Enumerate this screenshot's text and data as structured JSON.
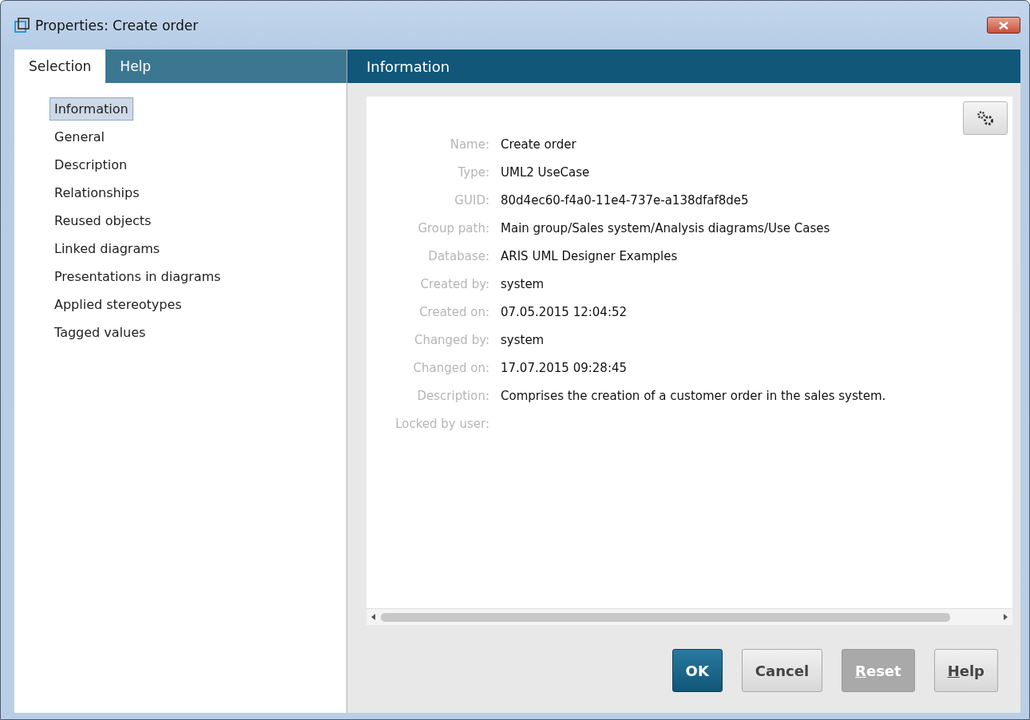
{
  "window": {
    "title": "Properties: Create order"
  },
  "tabs": [
    {
      "label": "Selection",
      "selected": true
    },
    {
      "label": "Help",
      "selected": false
    }
  ],
  "sidebar": {
    "items": [
      {
        "label": "Information",
        "selected": true
      },
      {
        "label": "General",
        "selected": false
      },
      {
        "label": "Description",
        "selected": false
      },
      {
        "label": "Relationships",
        "selected": false
      },
      {
        "label": "Reused objects",
        "selected": false
      },
      {
        "label": "Linked diagrams",
        "selected": false
      },
      {
        "label": "Presentations in diagrams",
        "selected": false
      },
      {
        "label": "Applied stereotypes",
        "selected": false
      },
      {
        "label": "Tagged values",
        "selected": false
      }
    ]
  },
  "panel": {
    "title": "Information",
    "properties": [
      {
        "label": "Name:",
        "value": "Create order"
      },
      {
        "label": "Type:",
        "value": "UML2 UseCase"
      },
      {
        "label": "GUID:",
        "value": "80d4ec60-f4a0-11e4-737e-a138dfaf8de5"
      },
      {
        "label": "Group path:",
        "value": "Main group/Sales system/Analysis diagrams/Use Cases"
      },
      {
        "label": "Database:",
        "value": "ARIS UML Designer Examples"
      },
      {
        "label": "Created by:",
        "value": "system"
      },
      {
        "label": "Created on:",
        "value": "07.05.2015 12:04:52"
      },
      {
        "label": "Changed by:",
        "value": "system"
      },
      {
        "label": "Changed on:",
        "value": "17.07.2015 09:28:45"
      },
      {
        "label": "Description:",
        "value": "Comprises the creation of a customer order in the sales system."
      },
      {
        "label": "Locked by user:"
      }
    ]
  },
  "buttons": [
    {
      "label": "OK",
      "default": true,
      "disabled": false,
      "mnemonic": false
    },
    {
      "label": "Cancel",
      "default": false,
      "disabled": false,
      "mnemonic": false
    },
    {
      "label": "Reset",
      "default": false,
      "disabled": true,
      "mnemonic": true
    },
    {
      "label": "Help",
      "default": false,
      "disabled": false,
      "mnemonic": true
    }
  ]
}
